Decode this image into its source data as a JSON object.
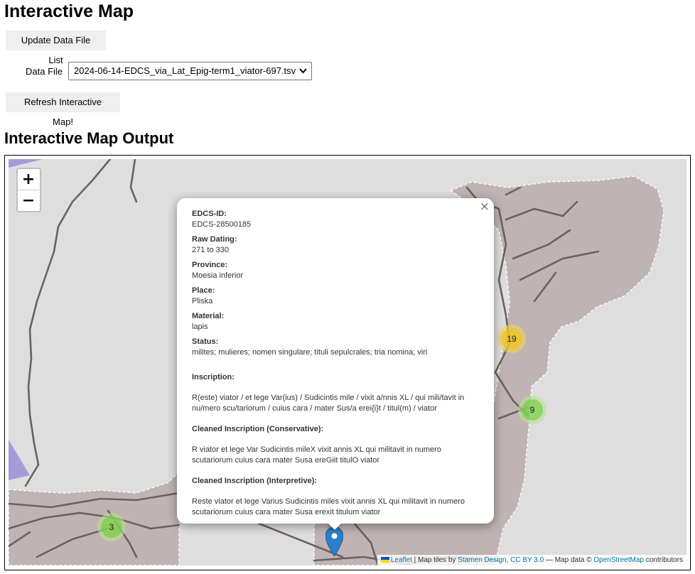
{
  "page": {
    "title": "Interactive Map",
    "output_heading": "Interactive Map Output"
  },
  "controls": {
    "update_button": "Update Data File List",
    "data_file_label": "Data File",
    "data_file_selected": "2024-06-14-EDCS_via_Lat_Epig-term1_viator-697.tsv",
    "refresh_button": "Refresh Interactive Map!"
  },
  "map": {
    "zoom_in": "+",
    "zoom_out": "−",
    "clusters": [
      {
        "count": "19",
        "color": "yellow"
      },
      {
        "count": "9",
        "color": "green"
      },
      {
        "count": "3",
        "color": "green"
      }
    ],
    "colors": {
      "land": "#c0b3b3",
      "water": "#dedede",
      "road": "#6b6161",
      "region": "#a59bd8",
      "marker": "#2a81cb"
    },
    "attribution": {
      "leaflet": "Leaflet",
      "tiles_prefix": "| Map tiles by",
      "stamen": "Stamen Design",
      "sep": ",",
      "license": "CC BY 3.0",
      "data_prefix": "— Map data ©",
      "osm": "OpenStreetMap",
      "suffix": "contributors"
    }
  },
  "popup": {
    "close": "×",
    "edcs_label": "EDCS-ID:",
    "edcs_value": "EDCS-28500185",
    "dating_label": "Raw Dating:",
    "dating_value": "271 to 330",
    "province_label": "Province:",
    "province_value": "Moesia inferior",
    "place_label": "Place:",
    "place_value": "Pliska",
    "material_label": "Material:",
    "material_value": "lapis",
    "status_label": "Status:",
    "status_value": "milites; mulieres; nomen singulare; tituli sepulcrales; tria nomina; viri",
    "inscription_label": "Inscription:",
    "inscription_value": "R(este) viator / et lege Var(ius) / Sudicintis mile / vixit a/nnis XL / qui mili/tavit in nu/mero scu/tariorum / cuius cara / mater Sus/a erei{i}t / titul(m) / viator",
    "conservative_label": "Cleaned Inscription (Conservative):",
    "conservative_value": "R viator et lege Var Sudicintis mileX vixit annis XL qui militavit in numero scutariorum cuius cara mater Susa ereGiit titulO viator",
    "interpretive_label": "Cleaned Inscription (Interpretive):",
    "interpretive_value": "Reste viator et lege Varius Sudicintis miles vixit annis XL qui militavit in numero scutariorum cuius cara mater Susa erexit titulum viator"
  }
}
